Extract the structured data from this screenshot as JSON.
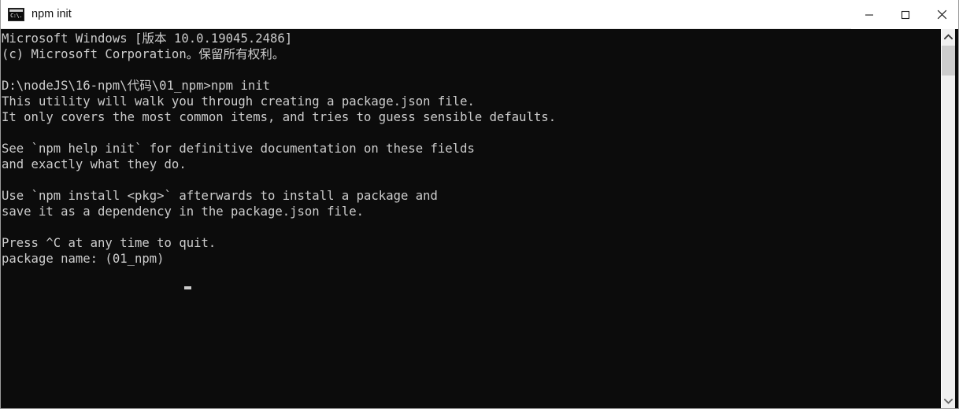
{
  "window": {
    "title": "npm init",
    "icon": "console-icon",
    "icon_glyph": "C:\\.",
    "background_color": "#0c0c0c",
    "text_color": "#cccccc",
    "titlebar_color": "#ffffff",
    "controls": {
      "minimize_label": "Minimize",
      "maximize_label": "Maximize",
      "close_label": "Close"
    }
  },
  "terminal": {
    "lines": [
      "Microsoft Windows [版本 10.0.19045.2486]",
      "(c) Microsoft Corporation。保留所有权利。",
      "",
      "D:\\nodeJS\\16-npm\\代码\\01_npm>npm init",
      "This utility will walk you through creating a package.json file.",
      "It only covers the most common items, and tries to guess sensible defaults.",
      "",
      "See `npm help init` for definitive documentation on these fields",
      "and exactly what they do.",
      "",
      "Use `npm install <pkg>` afterwards to install a package and",
      "save it as a dependency in the package.json file.",
      "",
      "Press ^C at any time to quit.",
      "package name: (01_npm)"
    ],
    "full_text": "Microsoft Windows [版本 10.0.19045.2486]\n(c) Microsoft Corporation。保留所有权利。\n\nD:\\nodeJS\\16-npm\\代码\\01_npm>npm init\nThis utility will walk you through creating a package.json file.\nIt only covers the most common items, and tries to guess sensible defaults.\n\nSee `npm help init` for definitive documentation on these fields\nand exactly what they do.\n\nUse `npm install <pkg>` afterwards to install a package and\nsave it as a dependency in the package.json file.\n\nPress ^C at any time to quit.\npackage name: (01_npm)",
    "prompt_path": "D:\\nodeJS\\16-npm\\代码\\01_npm",
    "command": "npm init",
    "current_prompt_label": "package name:",
    "current_prompt_default": "(01_npm)",
    "cursor_visible": true
  },
  "scrollbar": {
    "up_arrow": "chevron-up-icon",
    "down_arrow": "chevron-down-icon",
    "thumb_position": "top"
  }
}
